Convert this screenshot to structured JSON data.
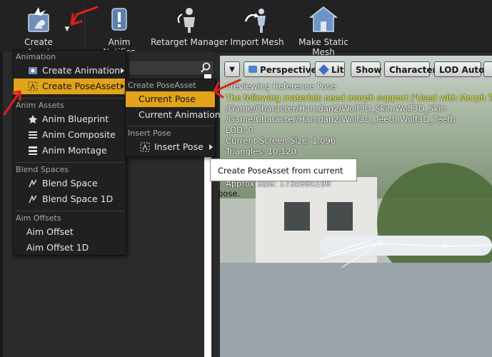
{
  "toolbar": {
    "create_asset": "Create Asset",
    "anim_notifies": "Anim Notifies",
    "retarget_manager": "Retarget Manager",
    "import_mesh": "Import Mesh",
    "make_static_mesh": "Make Static Mesh"
  },
  "viewport": {
    "perspective": "Perspective",
    "lit": "Lit",
    "show": "Show",
    "character": "Character",
    "lod_auto": "LOD Auto",
    "info": [
      "Previewing Reference Pose",
      "The following materials need morph support ('Used with Morph Targets')",
      "/Game/Character/Hamdan2/Wolf3D_Skin.Wolf3D_Skin",
      "/Game/Character/Hamdan2/Wolf3D_Teeth.Wolf3D_Teeth",
      "LOD: 0",
      "Current Screen Size: 1.096",
      "Triangles: 10,120",
      "Approx Size: 173x99x199"
    ]
  },
  "menu": {
    "sections": {
      "animation": "Animation",
      "anim_assets": "Anim Assets",
      "blend_spaces": "Blend Spaces",
      "aim_offsets": "Aim Offsets"
    },
    "items": {
      "create_animation": "Create Animation",
      "create_poseasset": "Create PoseAsset",
      "anim_blueprint": "Anim Blueprint",
      "anim_composite": "Anim Composite",
      "anim_montage": "Anim Montage",
      "blend_space": "Blend Space",
      "blend_space_1d": "Blend Space 1D",
      "aim_offset": "Aim Offset",
      "aim_offset_1d": "Aim Offset 1D"
    }
  },
  "submenu": {
    "create_header": "Create PoseAsset",
    "current_pose": "Current Pose",
    "current_animation": "Current Animation",
    "insert_header": "Insert Pose",
    "insert_pose": "Insert Pose"
  },
  "tooltip": "Create PoseAsset from current pose.",
  "colors": {
    "highlight": "#e1a31a",
    "scribble": "#e0201a",
    "warning_text": "#f4ff3c"
  },
  "icons": [
    "create-asset-icon",
    "anim-notifies-icon",
    "retarget-manager-icon",
    "import-mesh-icon",
    "make-static-mesh-icon",
    "search-icon"
  ]
}
